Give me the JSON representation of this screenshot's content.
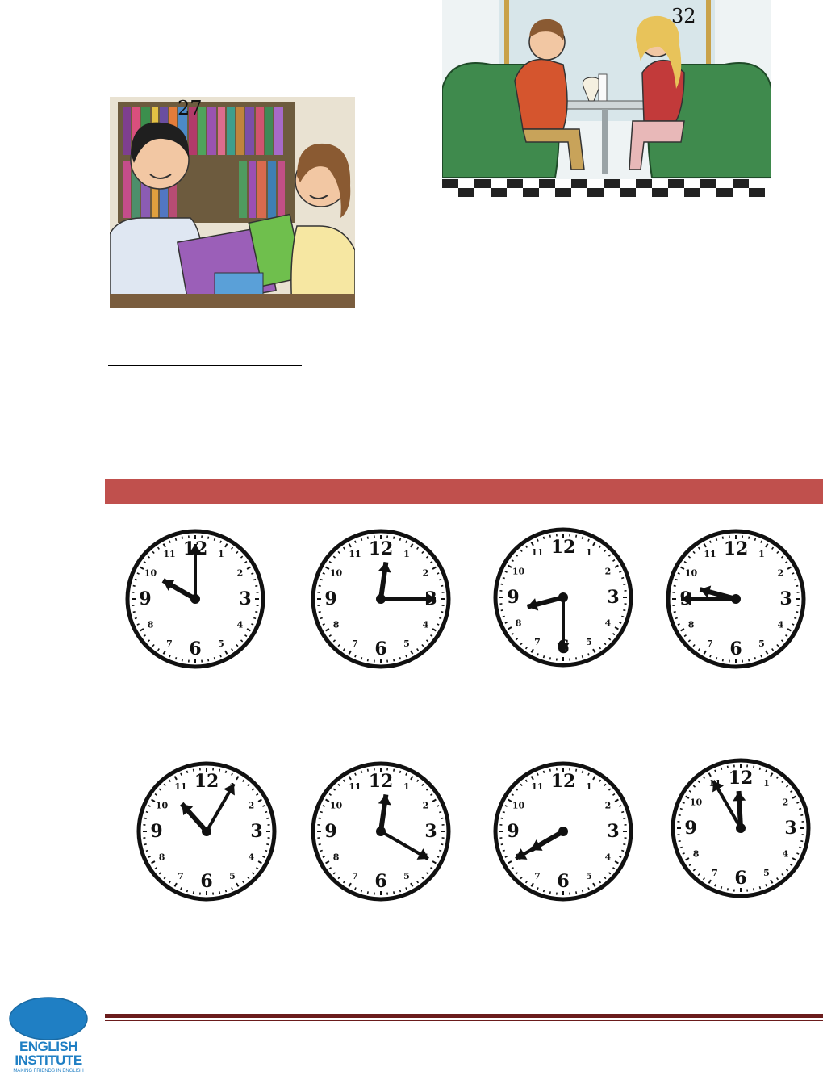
{
  "illustrations": {
    "library": {
      "number": "27",
      "icon": "students-library-icon"
    },
    "diner": {
      "number": "32",
      "icon": "couple-diner-icon"
    }
  },
  "clocks": [
    {
      "hour_hand_deg": 300,
      "minute_hand_deg": 0
    },
    {
      "hour_hand_deg": 8,
      "minute_hand_deg": 90
    },
    {
      "hour_hand_deg": 255,
      "minute_hand_deg": 180
    },
    {
      "hour_hand_deg": 285,
      "minute_hand_deg": 270
    },
    {
      "hour_hand_deg": 318,
      "minute_hand_deg": 30
    },
    {
      "hour_hand_deg": 8,
      "minute_hand_deg": 120
    },
    {
      "hour_hand_deg": 240,
      "minute_hand_deg": 240
    },
    {
      "hour_hand_deg": 357,
      "minute_hand_deg": 330
    }
  ],
  "clock_numerals": [
    "12",
    "1",
    "2",
    "3",
    "4",
    "5",
    "6",
    "7",
    "8",
    "9",
    "10",
    "11"
  ],
  "colors": {
    "banner": "#c0504d",
    "footer_rule": "#6b1c1c",
    "logo_blue": "#1f7fc4"
  },
  "footer": {
    "logo_title_line1": "ENGLISH",
    "logo_title_line2": "INSTITUTE",
    "logo_tagline": "MAKING FRIENDS IN ENGLISH"
  }
}
